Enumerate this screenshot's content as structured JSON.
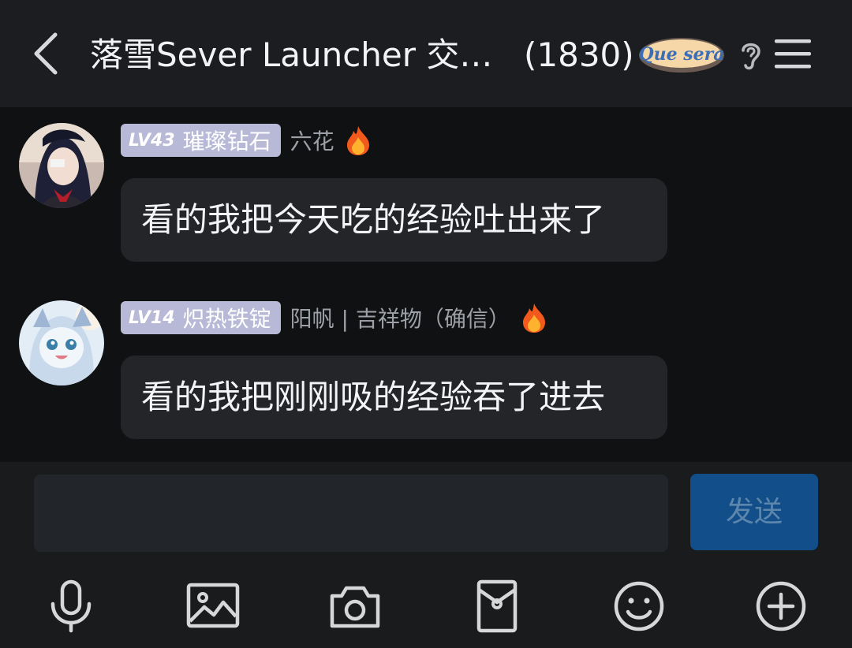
{
  "header": {
    "title": "落雪Sever Launcher 交…",
    "member_count": "(1830)",
    "badge_text": "Que sera",
    "icons": [
      "back-icon",
      "ear-icon",
      "menu-icon"
    ]
  },
  "messages": [
    {
      "level": "LV43",
      "rank": "璀璨钻石",
      "nickname": "六花",
      "text": "看的我把今天吃的经验吐出来了"
    },
    {
      "level": "LV14",
      "rank": "炽热铁锭",
      "nickname": "阳帆 | 吉祥物（确信）",
      "text": "看的我把刚刚吸的经验吞了进去"
    }
  ],
  "input": {
    "placeholder": "",
    "send_label": "发送"
  },
  "toolbar": [
    "microphone-icon",
    "image-icon",
    "camera-icon",
    "red-packet-icon",
    "emoji-icon",
    "plus-icon"
  ],
  "colors": {
    "header_bg": "#1b1d21",
    "chat_bg": "#101112",
    "bubble_bg": "#232529",
    "level_badge_bg": "#b8b9d6",
    "send_button_bg": "#124f8a"
  }
}
